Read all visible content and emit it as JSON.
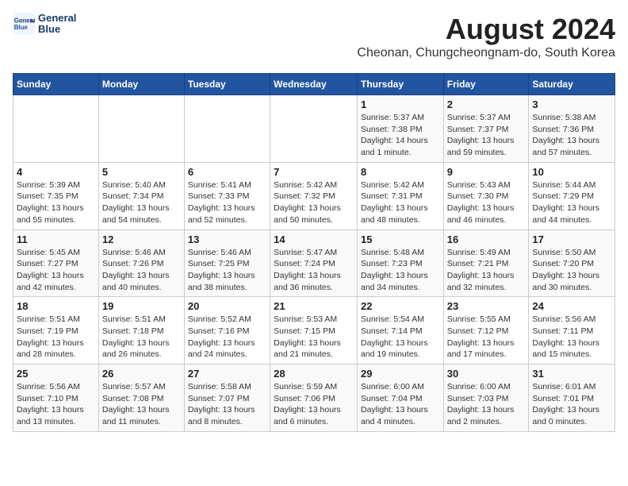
{
  "logo": {
    "line1": "General",
    "line2": "Blue"
  },
  "title": "August 2024",
  "subtitle": "Cheonan, Chungcheongnam-do, South Korea",
  "headers": [
    "Sunday",
    "Monday",
    "Tuesday",
    "Wednesday",
    "Thursday",
    "Friday",
    "Saturday"
  ],
  "weeks": [
    [
      {
        "day": "",
        "info": ""
      },
      {
        "day": "",
        "info": ""
      },
      {
        "day": "",
        "info": ""
      },
      {
        "day": "",
        "info": ""
      },
      {
        "day": "1",
        "info": "Sunrise: 5:37 AM\nSunset: 7:38 PM\nDaylight: 14 hours\nand 1 minute."
      },
      {
        "day": "2",
        "info": "Sunrise: 5:37 AM\nSunset: 7:37 PM\nDaylight: 13 hours\nand 59 minutes."
      },
      {
        "day": "3",
        "info": "Sunrise: 5:38 AM\nSunset: 7:36 PM\nDaylight: 13 hours\nand 57 minutes."
      }
    ],
    [
      {
        "day": "4",
        "info": "Sunrise: 5:39 AM\nSunset: 7:35 PM\nDaylight: 13 hours\nand 55 minutes."
      },
      {
        "day": "5",
        "info": "Sunrise: 5:40 AM\nSunset: 7:34 PM\nDaylight: 13 hours\nand 54 minutes."
      },
      {
        "day": "6",
        "info": "Sunrise: 5:41 AM\nSunset: 7:33 PM\nDaylight: 13 hours\nand 52 minutes."
      },
      {
        "day": "7",
        "info": "Sunrise: 5:42 AM\nSunset: 7:32 PM\nDaylight: 13 hours\nand 50 minutes."
      },
      {
        "day": "8",
        "info": "Sunrise: 5:42 AM\nSunset: 7:31 PM\nDaylight: 13 hours\nand 48 minutes."
      },
      {
        "day": "9",
        "info": "Sunrise: 5:43 AM\nSunset: 7:30 PM\nDaylight: 13 hours\nand 46 minutes."
      },
      {
        "day": "10",
        "info": "Sunrise: 5:44 AM\nSunset: 7:29 PM\nDaylight: 13 hours\nand 44 minutes."
      }
    ],
    [
      {
        "day": "11",
        "info": "Sunrise: 5:45 AM\nSunset: 7:27 PM\nDaylight: 13 hours\nand 42 minutes."
      },
      {
        "day": "12",
        "info": "Sunrise: 5:46 AM\nSunset: 7:26 PM\nDaylight: 13 hours\nand 40 minutes."
      },
      {
        "day": "13",
        "info": "Sunrise: 5:46 AM\nSunset: 7:25 PM\nDaylight: 13 hours\nand 38 minutes."
      },
      {
        "day": "14",
        "info": "Sunrise: 5:47 AM\nSunset: 7:24 PM\nDaylight: 13 hours\nand 36 minutes."
      },
      {
        "day": "15",
        "info": "Sunrise: 5:48 AM\nSunset: 7:23 PM\nDaylight: 13 hours\nand 34 minutes."
      },
      {
        "day": "16",
        "info": "Sunrise: 5:49 AM\nSunset: 7:21 PM\nDaylight: 13 hours\nand 32 minutes."
      },
      {
        "day": "17",
        "info": "Sunrise: 5:50 AM\nSunset: 7:20 PM\nDaylight: 13 hours\nand 30 minutes."
      }
    ],
    [
      {
        "day": "18",
        "info": "Sunrise: 5:51 AM\nSunset: 7:19 PM\nDaylight: 13 hours\nand 28 minutes."
      },
      {
        "day": "19",
        "info": "Sunrise: 5:51 AM\nSunset: 7:18 PM\nDaylight: 13 hours\nand 26 minutes."
      },
      {
        "day": "20",
        "info": "Sunrise: 5:52 AM\nSunset: 7:16 PM\nDaylight: 13 hours\nand 24 minutes."
      },
      {
        "day": "21",
        "info": "Sunrise: 5:53 AM\nSunset: 7:15 PM\nDaylight: 13 hours\nand 21 minutes."
      },
      {
        "day": "22",
        "info": "Sunrise: 5:54 AM\nSunset: 7:14 PM\nDaylight: 13 hours\nand 19 minutes."
      },
      {
        "day": "23",
        "info": "Sunrise: 5:55 AM\nSunset: 7:12 PM\nDaylight: 13 hours\nand 17 minutes."
      },
      {
        "day": "24",
        "info": "Sunrise: 5:56 AM\nSunset: 7:11 PM\nDaylight: 13 hours\nand 15 minutes."
      }
    ],
    [
      {
        "day": "25",
        "info": "Sunrise: 5:56 AM\nSunset: 7:10 PM\nDaylight: 13 hours\nand 13 minutes."
      },
      {
        "day": "26",
        "info": "Sunrise: 5:57 AM\nSunset: 7:08 PM\nDaylight: 13 hours\nand 11 minutes."
      },
      {
        "day": "27",
        "info": "Sunrise: 5:58 AM\nSunset: 7:07 PM\nDaylight: 13 hours\nand 8 minutes."
      },
      {
        "day": "28",
        "info": "Sunrise: 5:59 AM\nSunset: 7:06 PM\nDaylight: 13 hours\nand 6 minutes."
      },
      {
        "day": "29",
        "info": "Sunrise: 6:00 AM\nSunset: 7:04 PM\nDaylight: 13 hours\nand 4 minutes."
      },
      {
        "day": "30",
        "info": "Sunrise: 6:00 AM\nSunset: 7:03 PM\nDaylight: 13 hours\nand 2 minutes."
      },
      {
        "day": "31",
        "info": "Sunrise: 6:01 AM\nSunset: 7:01 PM\nDaylight: 13 hours\nand 0 minutes."
      }
    ]
  ]
}
